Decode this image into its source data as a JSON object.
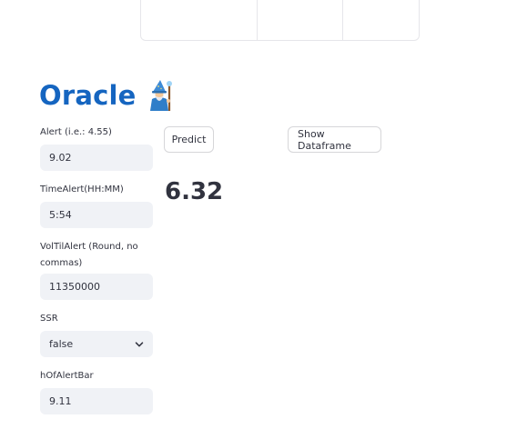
{
  "app": {
    "title": "Oracle",
    "title_icon": "wizard-icon"
  },
  "inputs": [
    {
      "label": "Alert (i.e.: 4.55)",
      "value": "9.02"
    },
    {
      "label": "TimeAlert(HH:MM)",
      "value": "5:54"
    },
    {
      "label": "VolTilAlert (Round, no commas)",
      "value": "11350000"
    },
    {
      "label": "SSR",
      "value": "false",
      "type": "select"
    },
    {
      "label": "hOfAlertBar",
      "value": "9.11"
    }
  ],
  "actions": {
    "predict_label": "Predict",
    "show_dataframe_label": "Show Dataframe"
  },
  "result": {
    "prediction": "6.32"
  },
  "colors": {
    "title": "#1565c0",
    "input_bg": "#f0f2f6",
    "text": "#31333f",
    "border": "#d6d6d9"
  }
}
